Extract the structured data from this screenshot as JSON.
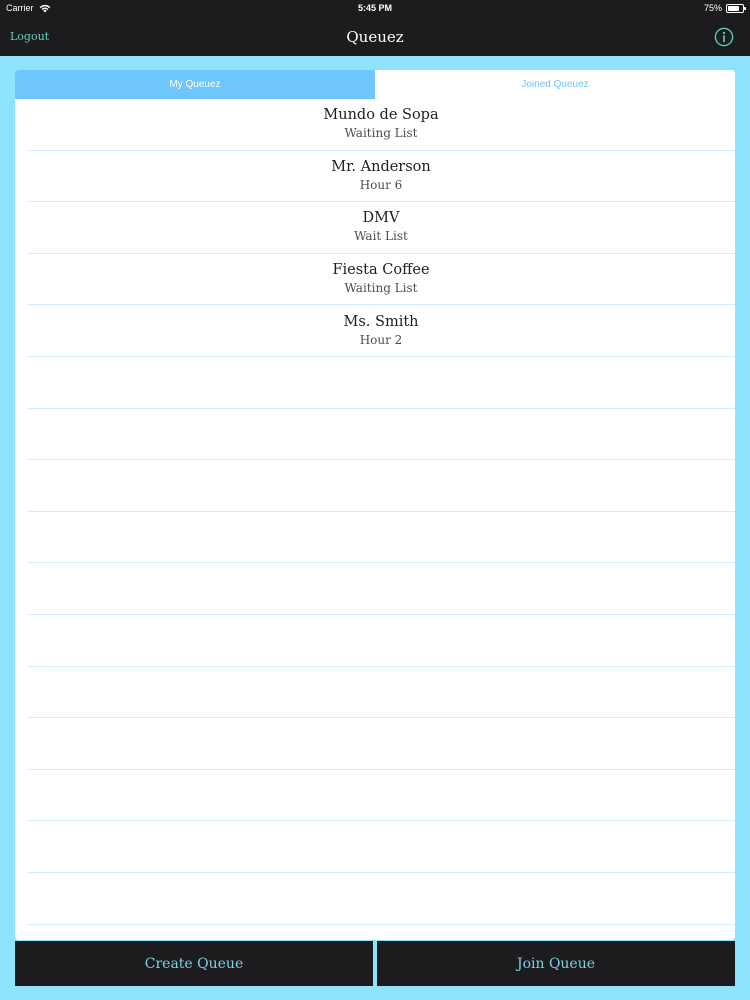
{
  "status": {
    "carrier": "Carrier",
    "time": "5:45 PM",
    "battery": "75%",
    "battery_level": 0.75
  },
  "nav": {
    "left_label": "Logout",
    "title": "Queuez",
    "right_icon": "info-icon"
  },
  "tabs": [
    {
      "label": "My Queuez",
      "selected": true
    },
    {
      "label": "Joined Queuez",
      "selected": false
    }
  ],
  "queues": [
    {
      "name": "Mundo de Sopa",
      "detail": "Waiting List"
    },
    {
      "name": "Mr. Anderson",
      "detail": "Hour 6"
    },
    {
      "name": "DMV",
      "detail": "Wait List"
    },
    {
      "name": "Fiesta Coffee",
      "detail": "Waiting List"
    },
    {
      "name": "Ms. Smith",
      "detail": "Hour 2"
    }
  ],
  "actions": {
    "create": "Create Queue",
    "join": "Join Queue"
  },
  "colors": {
    "background": "#8fe3fb",
    "bar": "#1c1c1e",
    "accent": "#6ec6fb",
    "logout": "#5fd3c8",
    "button_text": "#7ed2e8"
  }
}
